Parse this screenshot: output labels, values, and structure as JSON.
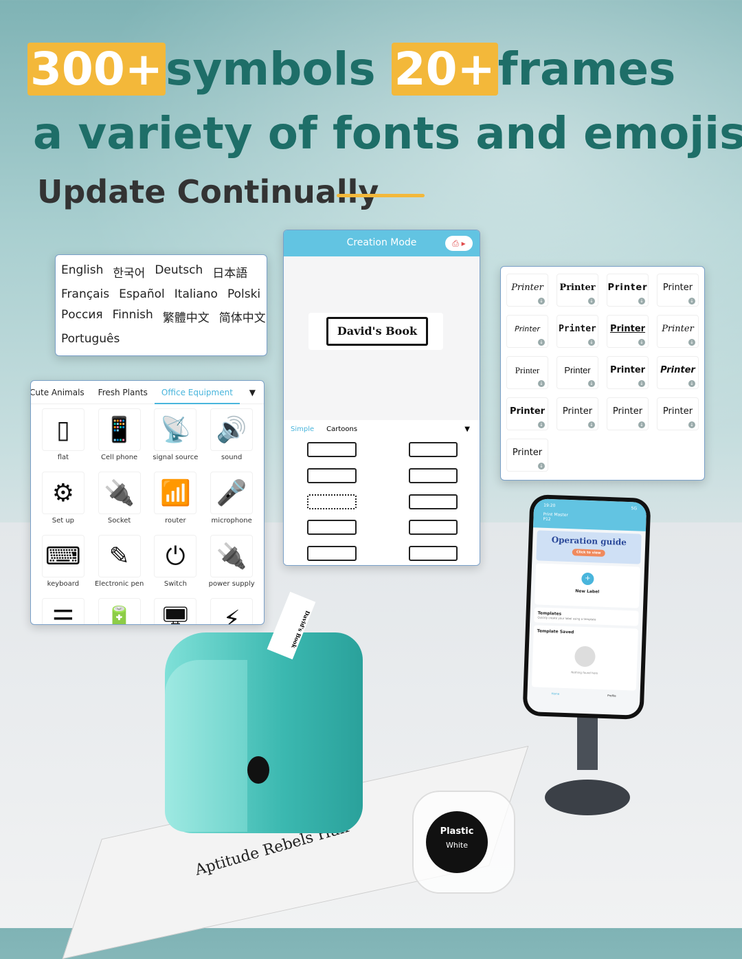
{
  "headline": {
    "badge1": "300+",
    "word1": "symbols",
    "badge2": "20+",
    "word2": "frames",
    "line2": "a variety of fonts and emojis",
    "line3": "Update Continually"
  },
  "colors": {
    "accent": "#f3b83a",
    "headline": "#1e6e68",
    "app_header": "#62c4e2"
  },
  "languages": [
    [
      "English",
      "한국어",
      "Deutsch",
      "日本語"
    ],
    [
      "Français",
      "Español",
      "Italiano",
      "Polski"
    ],
    [
      "Россия",
      "Finnish",
      "繁體中文",
      "简体中文"
    ],
    [
      "Português"
    ]
  ],
  "symbols": {
    "tabs": [
      "Cute Animals",
      "Fresh Plants",
      "Office Equipment"
    ],
    "active_tab": "Office Equipment",
    "items": [
      {
        "label": "flat",
        "icon": "tablet-icon",
        "glyph": "▯"
      },
      {
        "label": "Cell phone",
        "icon": "phone-icon",
        "glyph": "📱"
      },
      {
        "label": "signal source",
        "icon": "antenna-icon",
        "glyph": "📡"
      },
      {
        "label": "sound",
        "icon": "speaker-icon",
        "glyph": "🔊"
      },
      {
        "label": "Set up",
        "icon": "gears-icon",
        "glyph": "⚙"
      },
      {
        "label": "Socket",
        "icon": "power-strip-icon",
        "glyph": "🔌"
      },
      {
        "label": "router",
        "icon": "router-icon",
        "glyph": "📶"
      },
      {
        "label": "microphone",
        "icon": "microphone-icon",
        "glyph": "🎤"
      },
      {
        "label": "keyboard",
        "icon": "keyboard-icon",
        "glyph": "⌨"
      },
      {
        "label": "Electronic pen",
        "icon": "pen-icon",
        "glyph": "✎"
      },
      {
        "label": "Switch",
        "icon": "switch-icon",
        "glyph": "⏻"
      },
      {
        "label": "power supply",
        "icon": "plug-icon",
        "glyph": "🔌"
      },
      {
        "label": "",
        "icon": "server-icon",
        "glyph": "☰"
      },
      {
        "label": "",
        "icon": "battery-icon",
        "glyph": "🔋"
      },
      {
        "label": "",
        "icon": "monitor-icon",
        "glyph": "🖥"
      },
      {
        "label": "",
        "icon": "charger-icon",
        "glyph": "⚡"
      }
    ]
  },
  "creation": {
    "title": "Creation Mode",
    "label_text": "David's Book",
    "tabs": [
      "Simple",
      "Cartoons"
    ],
    "active_tab": "Simple"
  },
  "fonts": [
    "Printer",
    "Printer",
    "Printer",
    "Printer",
    "Printer",
    "Printer",
    "Printer",
    "Printer",
    "Printer",
    "Printer",
    "Printer",
    "Printer",
    "Printer",
    "Printer",
    "Printer",
    "Printer",
    "Printer"
  ],
  "phone": {
    "time": "19:20",
    "status": "5G",
    "app_name": "Print Master",
    "model": "P12",
    "banner": "Operation guide",
    "banner_cta": "Click to view",
    "new_label": "New Label",
    "templates_title": "Templates",
    "templates_sub": "Quickly create your label using a template",
    "saved_title": "Template Saved",
    "empty": "Nothing found here",
    "nav_home": "Home",
    "nav_profile": "Profile"
  },
  "product": {
    "tape_text": "David's Book",
    "cartridge_line1": "Plastic",
    "cartridge_line2": "White",
    "book_title": "Aptitude Rebels Hair"
  }
}
